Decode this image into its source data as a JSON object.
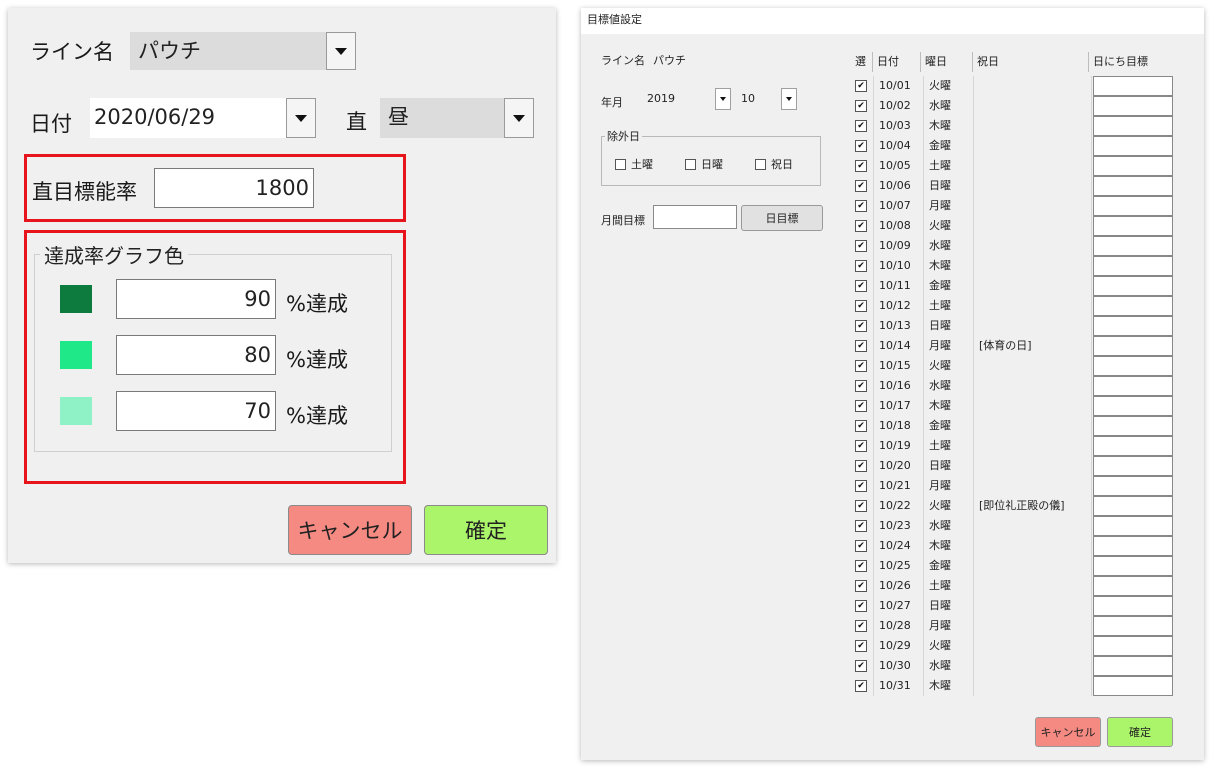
{
  "left_dialog": {
    "line_label": "ライン名",
    "line_value": "パウチ",
    "date_label": "日付",
    "date_value": "2020/06/29",
    "shift_label": "直",
    "shift_value": "昼",
    "target_label": "直目標能率",
    "target_value": "1800",
    "group_title": "達成率グラフ色",
    "thresholds": [
      {
        "value": "90",
        "suffix": "%達成",
        "color": "#0d7a3e"
      },
      {
        "value": "80",
        "suffix": "%達成",
        "color": "#1ee887"
      },
      {
        "value": "70",
        "suffix": "%達成",
        "color": "#8ff2c6"
      }
    ],
    "cancel_label": "キャンセル",
    "confirm_label": "確定",
    "highlight_color": "#e8141c",
    "cancel_color": "#f58a82",
    "confirm_color": "#aaf56a"
  },
  "right_dialog": {
    "title": "目標値設定",
    "line_label": "ライン名",
    "line_value": "パウチ",
    "yearmonth_label": "年月",
    "year_value": "2019",
    "month_value": "10",
    "exclude_title": "除外日",
    "exclude_options": [
      "土曜",
      "日曜",
      "祝日"
    ],
    "monthly_label": "月間目標",
    "monthly_value": "",
    "daily_button": "日目標",
    "columns": [
      "選",
      "日付",
      "曜日",
      "祝日",
      "日にち目標"
    ],
    "rows": [
      {
        "date": "10/01",
        "dow": "火曜",
        "holiday": "",
        "checked": true
      },
      {
        "date": "10/02",
        "dow": "水曜",
        "holiday": "",
        "checked": true
      },
      {
        "date": "10/03",
        "dow": "木曜",
        "holiday": "",
        "checked": true
      },
      {
        "date": "10/04",
        "dow": "金曜",
        "holiday": "",
        "checked": true
      },
      {
        "date": "10/05",
        "dow": "土曜",
        "holiday": "",
        "checked": true
      },
      {
        "date": "10/06",
        "dow": "日曜",
        "holiday": "",
        "checked": true
      },
      {
        "date": "10/07",
        "dow": "月曜",
        "holiday": "",
        "checked": true
      },
      {
        "date": "10/08",
        "dow": "火曜",
        "holiday": "",
        "checked": true
      },
      {
        "date": "10/09",
        "dow": "水曜",
        "holiday": "",
        "checked": true
      },
      {
        "date": "10/10",
        "dow": "木曜",
        "holiday": "",
        "checked": true
      },
      {
        "date": "10/11",
        "dow": "金曜",
        "holiday": "",
        "checked": true
      },
      {
        "date": "10/12",
        "dow": "土曜",
        "holiday": "",
        "checked": true
      },
      {
        "date": "10/13",
        "dow": "日曜",
        "holiday": "",
        "checked": true
      },
      {
        "date": "10/14",
        "dow": "月曜",
        "holiday": "[体育の日]",
        "checked": true
      },
      {
        "date": "10/15",
        "dow": "火曜",
        "holiday": "",
        "checked": true
      },
      {
        "date": "10/16",
        "dow": "水曜",
        "holiday": "",
        "checked": true
      },
      {
        "date": "10/17",
        "dow": "木曜",
        "holiday": "",
        "checked": true
      },
      {
        "date": "10/18",
        "dow": "金曜",
        "holiday": "",
        "checked": true
      },
      {
        "date": "10/19",
        "dow": "土曜",
        "holiday": "",
        "checked": true
      },
      {
        "date": "10/20",
        "dow": "日曜",
        "holiday": "",
        "checked": true
      },
      {
        "date": "10/21",
        "dow": "月曜",
        "holiday": "",
        "checked": true
      },
      {
        "date": "10/22",
        "dow": "火曜",
        "holiday": "[即位礼正殿の儀]",
        "checked": true
      },
      {
        "date": "10/23",
        "dow": "水曜",
        "holiday": "",
        "checked": true
      },
      {
        "date": "10/24",
        "dow": "木曜",
        "holiday": "",
        "checked": true
      },
      {
        "date": "10/25",
        "dow": "金曜",
        "holiday": "",
        "checked": true
      },
      {
        "date": "10/26",
        "dow": "土曜",
        "holiday": "",
        "checked": true
      },
      {
        "date": "10/27",
        "dow": "日曜",
        "holiday": "",
        "checked": true
      },
      {
        "date": "10/28",
        "dow": "月曜",
        "holiday": "",
        "checked": true
      },
      {
        "date": "10/29",
        "dow": "火曜",
        "holiday": "",
        "checked": true
      },
      {
        "date": "10/30",
        "dow": "水曜",
        "holiday": "",
        "checked": true
      },
      {
        "date": "10/31",
        "dow": "木曜",
        "holiday": "",
        "checked": true
      }
    ],
    "cancel_label": "キャンセル",
    "confirm_label": "確定"
  }
}
